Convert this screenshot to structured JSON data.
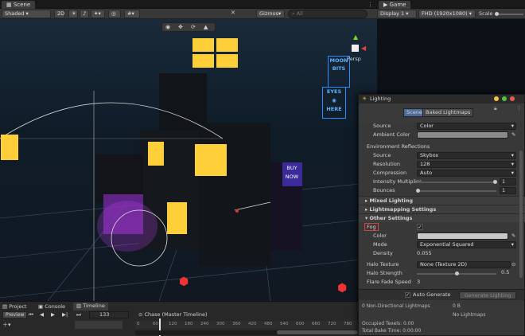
{
  "scene_tab": {
    "label": "Scene"
  },
  "game_tab": {
    "label": "Game"
  },
  "scene_toolbar": {
    "shading": "Shaded",
    "mode": "2D",
    "gizmos": "Gizmos",
    "search_placeholder": "All"
  },
  "game_toolbar": {
    "display": "Display 1",
    "resolution": "FHD (1920x1080)",
    "scale": "Scale"
  },
  "scene_view": {
    "persp": "Persp",
    "signs": [
      "MOON",
      "BITS",
      "EYES",
      "HERE",
      "BUY",
      "NOW"
    ]
  },
  "lighting": {
    "title": "Lighting",
    "tabs": [
      "Scene",
      "Baked Lightmaps"
    ],
    "source_label": "Source",
    "source_value": "Color",
    "ambient_label": "Ambient Color",
    "env_reflections": "Environment Reflections",
    "refl_source_label": "Source",
    "refl_source_value": "Skybox",
    "resolution_label": "Resolution",
    "resolution_value": "128",
    "compression_label": "Compression",
    "compression_value": "Auto",
    "intensity_label": "Intensity Multiplier",
    "intensity_value": "1",
    "bounces_label": "Bounces",
    "bounces_value": "1",
    "mixed_lighting": "Mixed Lighting",
    "lightmapping_settings": "Lightmapping Settings",
    "other_settings": "Other Settings",
    "fog_label": "Fog",
    "color_label": "Color",
    "mode_label": "Mode",
    "mode_value": "Exponential Squared",
    "density_label": "Density",
    "density_value": "0.055",
    "halo_texture_label": "Halo Texture",
    "halo_texture_value": "None (Texture 2D)",
    "halo_strength_label": "Halo Strength",
    "halo_strength_value": "0.5",
    "flare_fade_label": "Flare Fade Speed",
    "flare_fade_value": "3",
    "auto_generate": "Auto Generate",
    "generate_button": "Generate Lighting",
    "non_directional": "0 Non-Directional Lightmaps",
    "lightmap_size": "0 B",
    "no_lightmaps": "No Lightmaps",
    "occupied_texels": "Occupied Texels: 0.00",
    "total_bake_time": "Total Bake Time: 0:00:00"
  },
  "bottom": {
    "tabs": [
      "Project",
      "Console",
      "Timeline"
    ],
    "preview": "Preview",
    "frame": "133",
    "track_title": "Chase (Master Timeline)",
    "ruler": [
      "0",
      "60",
      "120",
      "180",
      "240",
      "300",
      "360",
      "420",
      "480",
      "540",
      "600",
      "660",
      "720",
      "780",
      "840",
      "900",
      "960",
      "1020",
      "1080",
      "1140",
      "1200",
      "1260"
    ]
  },
  "colors": {
    "accent": "#4c7fd1",
    "window": "#ffcf3a",
    "neon_blue": "#2a8cff",
    "neon_pink": "#d63cff",
    "fog_highlight": "#d94040"
  },
  "icons": [
    "close-icon",
    "lock-icon",
    "menu-icon",
    "play-icon",
    "pause-icon",
    "step-icon",
    "checkmark-icon",
    "eyedropper-icon",
    "target-icon"
  ]
}
